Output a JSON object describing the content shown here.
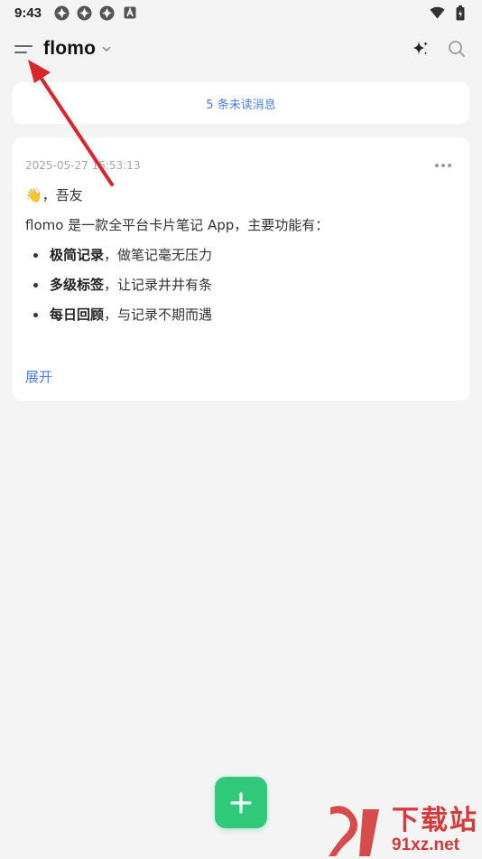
{
  "status_bar": {
    "time": "9:43",
    "left_icons": [
      "app-notification-icon",
      "app-notification-icon",
      "app-notification-icon",
      "a-badge-icon"
    ],
    "right_icons": [
      "wifi-icon",
      "battery-icon"
    ]
  },
  "header": {
    "title": "flomo",
    "icons": [
      "menu-icon",
      "chevron-down-icon",
      "sparkle-icon",
      "search-icon"
    ]
  },
  "unread": {
    "label": "5 条未读消息"
  },
  "memo": {
    "timestamp": "2025-05-27 15:53:13",
    "greeting": "👋，吾友",
    "intro": "flomo 是一款全平台卡片笔记 App，主要功能有：",
    "features": [
      {
        "bold": "极简记录",
        "rest": "，做笔记毫无压力"
      },
      {
        "bold": "多级标签",
        "rest": "，让记录井井有条"
      },
      {
        "bold": "每日回顾",
        "rest": "，与记录不期而遇"
      }
    ],
    "expand_label": "展开"
  },
  "colors": {
    "accent_blue": "#4a7fe0",
    "fab_green": "#30c879",
    "background": "#f4f4f5",
    "annotation_red": "#d9262a"
  },
  "watermark": {
    "cn": "下载站",
    "en": "91xz.net"
  }
}
